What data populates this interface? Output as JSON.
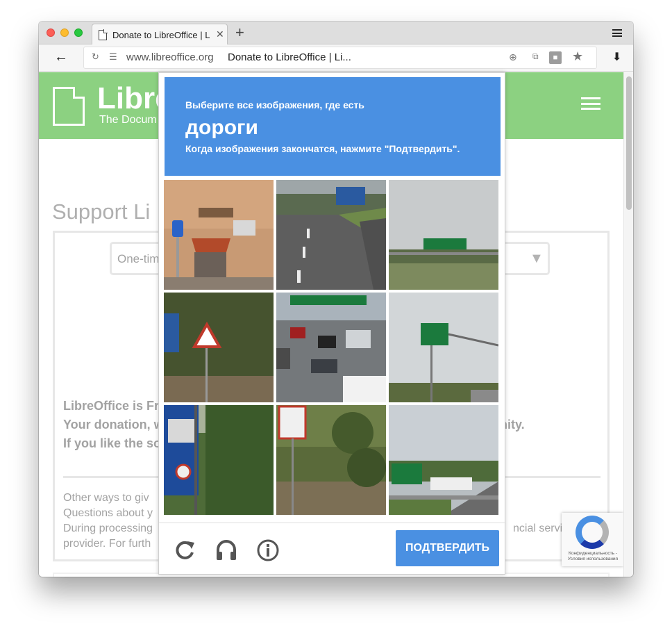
{
  "browser": {
    "tab_title": "Donate to LibreOffice | L",
    "tab_close": "✕",
    "new_tab": "+",
    "back": "←",
    "reload": "↻",
    "url_domain": "www.libreoffice.org",
    "url_page_title": "Donate to LibreOffice | Li...",
    "star": "★",
    "download": "⬇"
  },
  "site": {
    "logo_text": "Libre",
    "logo_sub": "The Docum",
    "support_title": "Support Li",
    "select_value": "One-tim",
    "select_arrow": "▼",
    "lines_left": [
      "LibreOffice is Fr",
      "Your donation, w",
      "If you like the so"
    ],
    "line_right": "unity.",
    "other_left": [
      "Other ways to giv",
      "Questions about y",
      "During processing",
      "provider. For furth"
    ],
    "other_right": "ncial servic"
  },
  "captcha": {
    "line1": "Выберите все изображения, где есть",
    "keyword": "дороги",
    "line3": "Когда изображения закончатся, нажмите \"Подтвердить\".",
    "verify_label": "ПОДТВЕРДИТЬ",
    "colors": {
      "accent": "#4a90e2"
    },
    "icons": [
      "reload-icon",
      "headphones-icon",
      "info-icon"
    ],
    "badge_text": "Конфиденциальность - Условия использования"
  }
}
